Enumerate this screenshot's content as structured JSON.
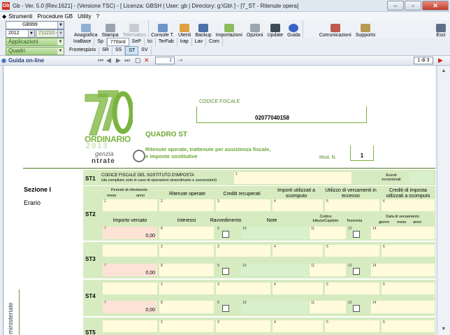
{
  "window": {
    "title": "Gb - Ver. 5.0 [Rev.1621] - (Versione TSC) -  [ Licenza: GBSH | User: gb | Directory: g:\\Gb\\ ] - [7_ST - Ritenute opera]",
    "app_icon": "Gb"
  },
  "menu": [
    "Strumenti",
    "Procedure GB",
    "Utility",
    "?"
  ],
  "left": {
    "code": "GB999",
    "year": "2012",
    "date": "711210 -",
    "applicazioni": "Applicazioni",
    "quadri": "Quadri"
  },
  "toolbar": [
    "Anagrafica",
    "Stampa",
    "Telematico",
    "Console T.",
    "Utenti",
    "Backup",
    "Importazioni",
    "Opzioni",
    "Update",
    "Guida",
    "Comunicazioni",
    "Supporto",
    "Esci"
  ],
  "nav_tabs": [
    "IvaBase",
    "Sp",
    "770ord",
    "SeP",
    "Ici",
    "TerFab",
    "Irap",
    "Lav",
    "Com"
  ],
  "quadri_tabs": [
    "Frontespizio",
    "SR",
    "SS",
    "ST",
    "SV"
  ],
  "guida": "Guida on-line",
  "page": {
    "current": "1",
    "of": "1 di 3"
  },
  "form": {
    "ordinario": "ORDINARIO",
    "anno": "2013",
    "agenzia": "genzia",
    "entrate": "ntrate",
    "codice_fiscale_label": "CODICE FISCALE",
    "codice_fiscale": "02077040158",
    "quadro": "QUADRO ST",
    "sub1": "Ritenute operate, trattenute per assistenza fiscale,",
    "sub2": "e imposte sostitutive",
    "mod_n_label": "Mod. N.",
    "mod_n": "1",
    "st1": "ST1",
    "st1_title": "CODICE FISCALE DEL SOSTITUTO D'IMPOSTA",
    "st1_sub": "(da compilare solo in caso di operazioni straordinarie e successioni)",
    "eventi": "Eventi eccezionali",
    "sezione": "Sezione I",
    "erario": "Erario",
    "headers": {
      "periodo": "Periodo di riferimento",
      "mese": "mese",
      "anno": "anno",
      "ritenute": "Ritenute operate",
      "crediti": "Crediti recuperati",
      "importi": "Importi utilizzati a scomputo",
      "utilizzo": "Utilizzo di versamenti in eccesso",
      "crediti_imposta": "Crediti di imposta utilizzati a scomputo",
      "importo_versato": "Importo versato",
      "interessi": "Interessi",
      "ravvedimento": "Ravvedimento",
      "note": "Note",
      "codice": "Codice tributo/Capitolo",
      "tesoreria": "Tesoreria",
      "data": "Data di versamento",
      "giorno": "giorno",
      "mese2": "mese",
      "anno2": "anno"
    },
    "rows": [
      {
        "label": "ST2",
        "importo": "0,00"
      },
      {
        "label": "ST3",
        "importo": "0,00"
      },
      {
        "label": "ST4",
        "importo": "0,00"
      },
      {
        "label": "ST5",
        "importo": ""
      }
    ],
    "ministeriale": "ministeriale"
  },
  "colors": {
    "green_accent": "#7ab43f",
    "field_yellow": "#fffbdc",
    "field_pink": "#fde3d6",
    "row_green": "#d7ebc0"
  }
}
